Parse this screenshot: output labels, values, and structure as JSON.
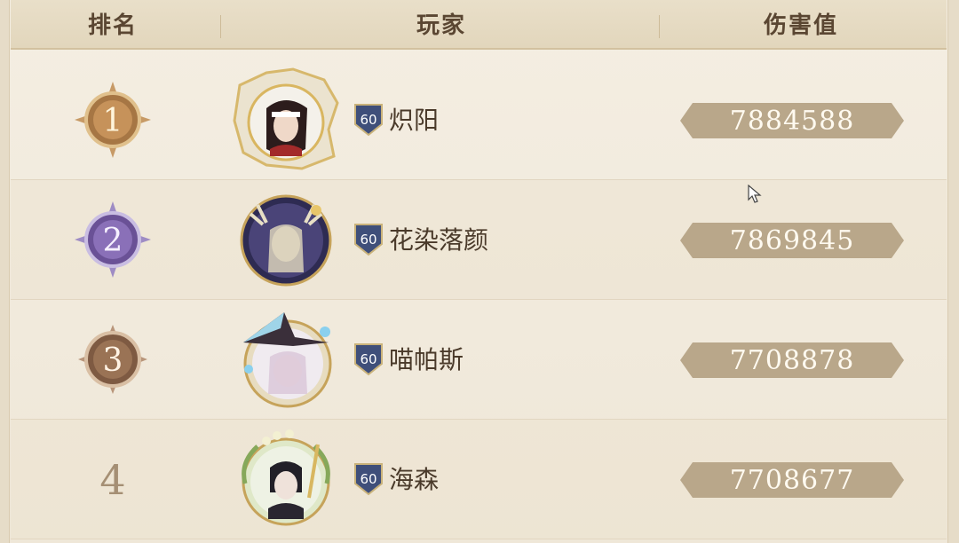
{
  "header": {
    "rank_label": "排名",
    "player_label": "玩家",
    "damage_label": "伤害值"
  },
  "rows": [
    {
      "rank": "1",
      "medal": "gold",
      "avatar": "avatar-white-hood",
      "level": "60",
      "name": "炽阳",
      "damage": "7884588"
    },
    {
      "rank": "2",
      "medal": "purple",
      "avatar": "avatar-antlers",
      "level": "60",
      "name": "花染落颜",
      "damage": "7869845"
    },
    {
      "rank": "3",
      "medal": "bronze",
      "avatar": "avatar-witch-hat",
      "level": "60",
      "name": "喵帕斯",
      "damage": "7708878"
    },
    {
      "rank": "4",
      "medal": "none",
      "avatar": "avatar-green-wreath",
      "level": "60",
      "name": "海森",
      "damage": "7708677"
    }
  ],
  "colors": {
    "gold": "#b8895a",
    "purple": "#7d63a8",
    "bronze": "#9a7355",
    "pill": "#b9a78a",
    "level_badge": "#3f4f7a"
  }
}
